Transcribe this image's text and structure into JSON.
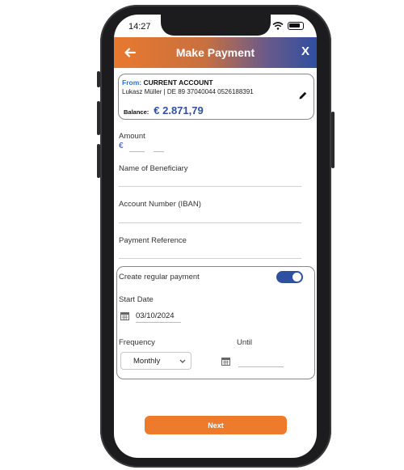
{
  "status": {
    "time": "14:27"
  },
  "header": {
    "title": "Make Payment",
    "close_label": "X"
  },
  "from_card": {
    "from_label": "From:",
    "account_name": "CURRENT ACCOUNT",
    "owner_line": "Lukasz Müller  |  DE 89 37040044 0526188391",
    "balance_label": "Balance:",
    "balance_value": "€ 2.871,79"
  },
  "form": {
    "amount_label": "Amount",
    "currency_symbol": "€",
    "beneficiary_label": "Name of Beneficiary",
    "iban_label": "Account Number (IBAN)",
    "reference_label": "Payment Reference"
  },
  "regular_payment": {
    "toggle_label": "Create regular payment",
    "toggle_on": true,
    "start_date_label": "Start Date",
    "start_date_value": "03/10/2024",
    "frequency_label": "Frequency",
    "frequency_value": "Monthly",
    "until_label": "Until"
  },
  "actions": {
    "next_label": "Next"
  },
  "colors": {
    "accent_orange": "#ee7b2c",
    "accent_blue": "#2f4fa0",
    "link_blue": "#2f6cd8"
  },
  "icons": [
    "back-arrow-icon",
    "close-icon",
    "edit-pencil-icon",
    "calendar-icon",
    "chevron-down-icon",
    "wifi-icon",
    "battery-icon"
  ]
}
